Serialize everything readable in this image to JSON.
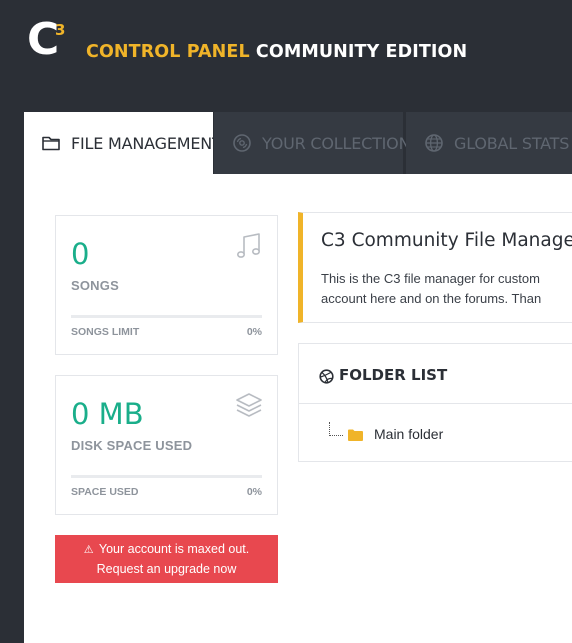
{
  "header": {
    "logo_letter": "C",
    "logo_sup": "3",
    "title_accent": "CONTROL PANEL",
    "title_rest": "COMMUNITY EDITION"
  },
  "tabs": [
    {
      "label": "FILE MANAGEMENT",
      "icon": "folder-outline-icon",
      "active": true
    },
    {
      "label": "YOUR COLLECTION",
      "icon": "compact-disc-icon",
      "active": false
    },
    {
      "label": "GLOBAL STATS",
      "icon": "globe-icon",
      "active": false
    }
  ],
  "songs_card": {
    "value": "0",
    "label": "SONGS",
    "icon": "music-note-icon",
    "limit_label": "SONGS LIMIT",
    "limit_pct": "0%",
    "progress": 0
  },
  "disk_card": {
    "value": "0 MB",
    "label": "DISK SPACE USED",
    "icon": "layers-icon",
    "limit_label": "SPACE USED",
    "limit_pct": "0%",
    "progress": 0
  },
  "alert": {
    "line1": "Your account is maxed out.",
    "line2": "Request an upgrade now",
    "color": "#e8484f"
  },
  "notice": {
    "title": "C3 Community File Manage",
    "line1": "This is the C3 file manager for custom",
    "line2": "account here and on the forums. Than"
  },
  "folder_list": {
    "title": "FOLDER LIST",
    "icon": "dribbble-ball-icon",
    "items": [
      {
        "label": "Main folder",
        "icon": "folder-icon"
      }
    ]
  },
  "colors": {
    "accent": "#f0b429",
    "stat_green": "#1aae8a",
    "header_bg": "#2b2f36"
  }
}
